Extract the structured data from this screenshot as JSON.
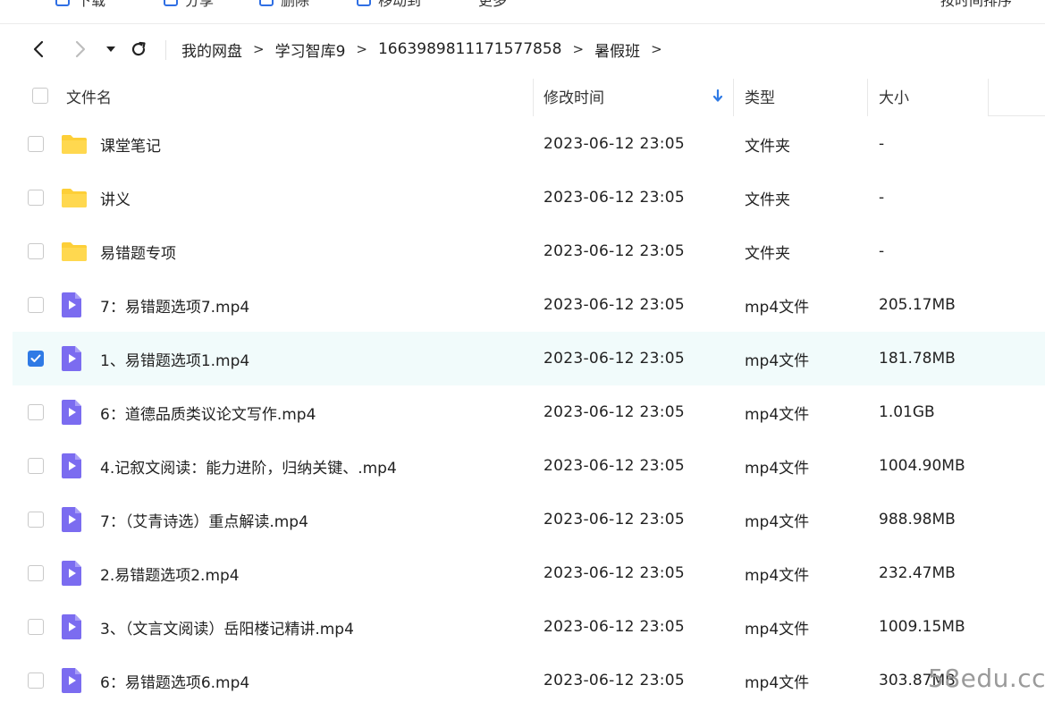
{
  "toolbar": {
    "items": [
      "下载",
      "分享",
      "删除",
      "移动到",
      "更多"
    ],
    "right_text": "按时间排序"
  },
  "breadcrumbs": [
    "我的网盘",
    "学习智库9",
    "1663989811171577858",
    "暑假班"
  ],
  "header": {
    "name": "文件名",
    "time": "修改时间",
    "type": "类型",
    "size": "大小",
    "sort_icon": "arrow-down-icon"
  },
  "files": [
    {
      "name": "课堂笔记",
      "time": "2023-06-12 23:05",
      "type": "文件夹",
      "size": "-",
      "kind": "folder",
      "checked": false
    },
    {
      "name": "讲义",
      "time": "2023-06-12 23:05",
      "type": "文件夹",
      "size": "-",
      "kind": "folder",
      "checked": false
    },
    {
      "name": "易错题专项",
      "time": "2023-06-12 23:05",
      "type": "文件夹",
      "size": "-",
      "kind": "folder",
      "checked": false
    },
    {
      "name": "7：易错题选项7.mp4",
      "time": "2023-06-12 23:05",
      "type": "mp4文件",
      "size": "205.17MB",
      "kind": "video",
      "checked": false
    },
    {
      "name": "1、易错题选项1.mp4",
      "time": "2023-06-12 23:05",
      "type": "mp4文件",
      "size": "181.78MB",
      "kind": "video",
      "checked": true
    },
    {
      "name": "6：道德品质类议论文写作.mp4",
      "time": "2023-06-12 23:05",
      "type": "mp4文件",
      "size": "1.01GB",
      "kind": "video",
      "checked": false
    },
    {
      "name": "4.记叙文阅读：能力进阶，归纳关键、.mp4",
      "time": "2023-06-12 23:05",
      "type": "mp4文件",
      "size": "1004.90MB",
      "kind": "video",
      "checked": false
    },
    {
      "name": "7：（艾青诗选）重点解读.mp4",
      "time": "2023-06-12 23:05",
      "type": "mp4文件",
      "size": "988.98MB",
      "kind": "video",
      "checked": false
    },
    {
      "name": "2.易错题选项2.mp4",
      "time": "2023-06-12 23:05",
      "type": "mp4文件",
      "size": "232.47MB",
      "kind": "video",
      "checked": false
    },
    {
      "name": "3、（文言文阅读）岳阳楼记精讲.mp4",
      "time": "2023-06-12 23:05",
      "type": "mp4文件",
      "size": "1009.15MB",
      "kind": "video",
      "checked": false
    },
    {
      "name": "6：易错题选项6.mp4",
      "time": "2023-06-12 23:05",
      "type": "mp4文件",
      "size": "303.87MB",
      "kind": "video",
      "checked": false
    }
  ],
  "colors": {
    "accent": "#2f7ae5",
    "folder": "#fdcf38",
    "video": "#7b6cf0",
    "selected_row": "#f1fbfb"
  },
  "watermark": "58edu.cc"
}
